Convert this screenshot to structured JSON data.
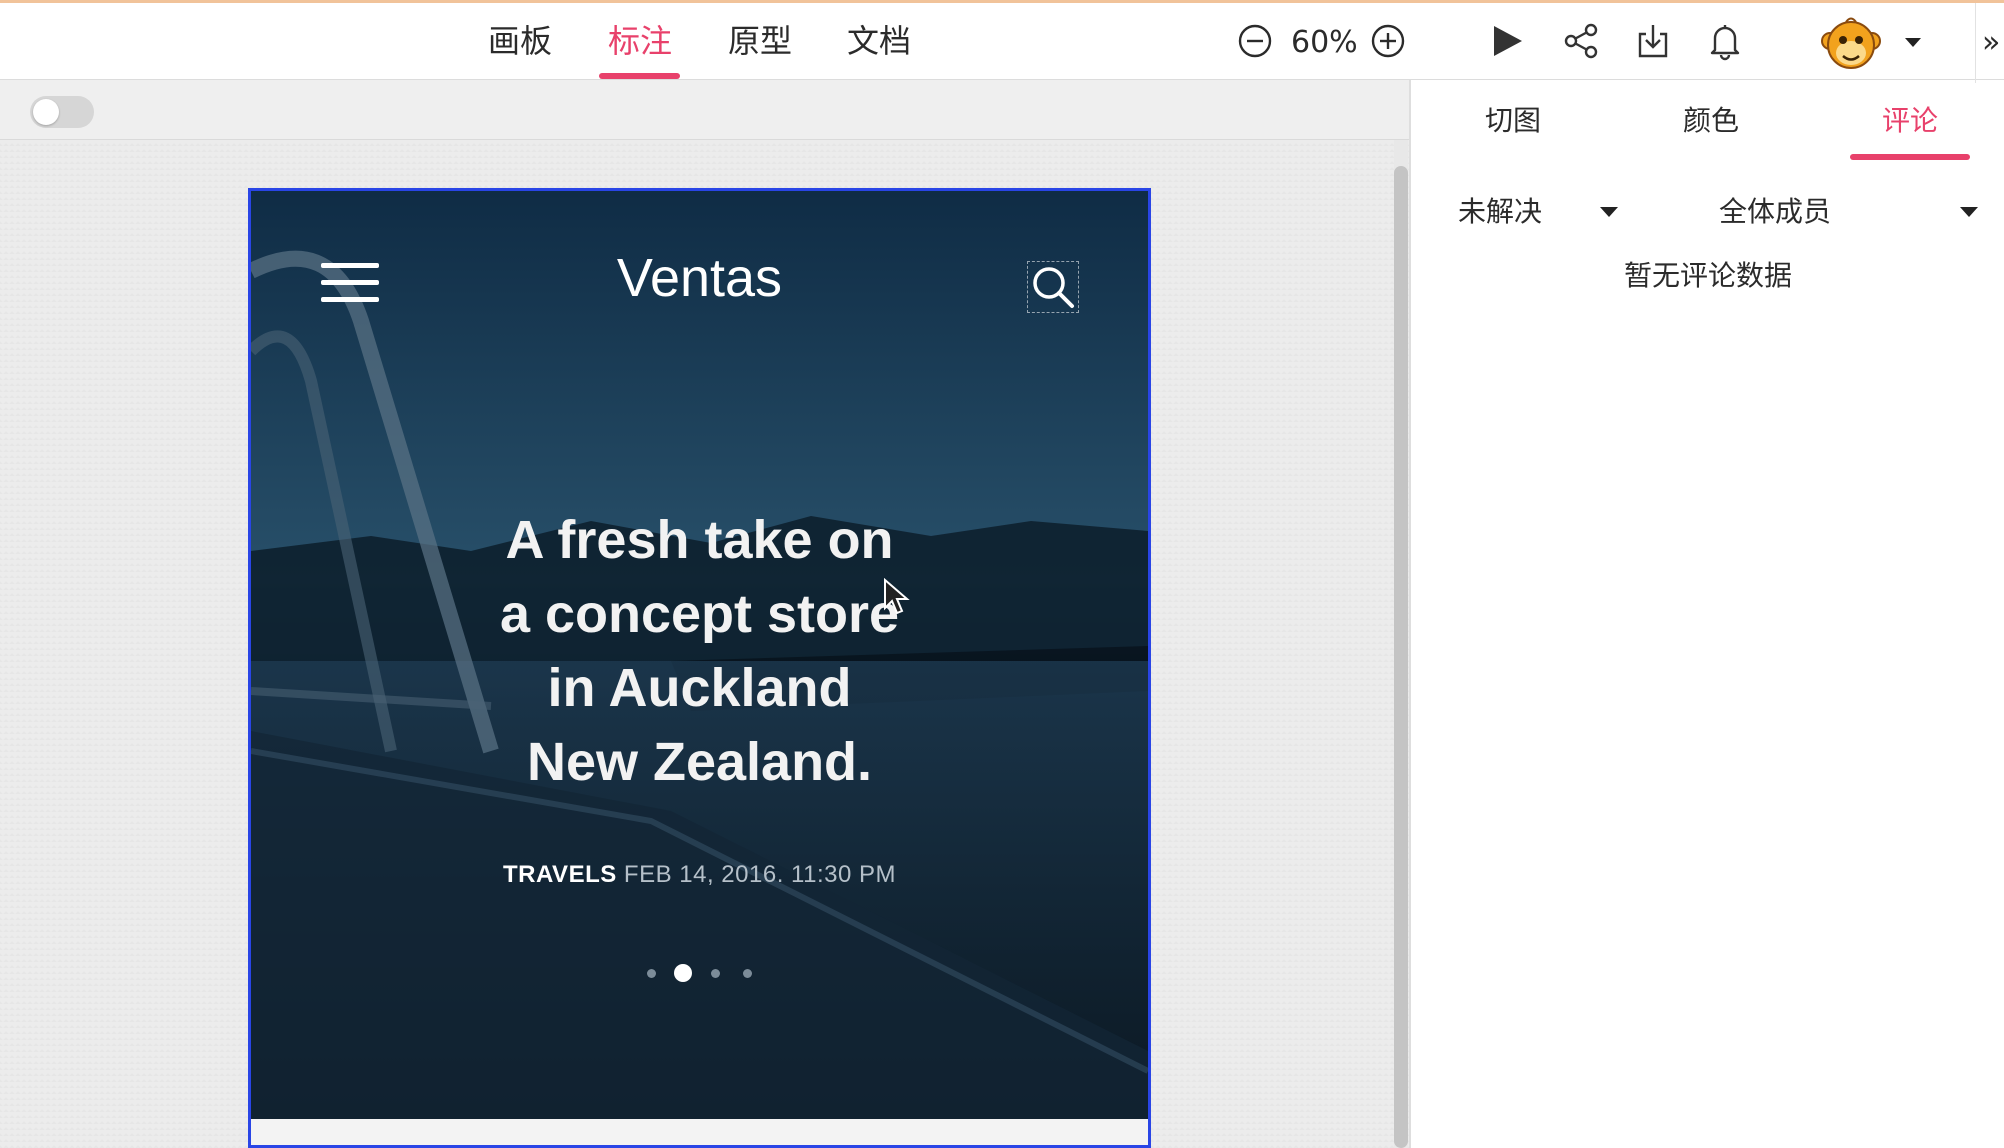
{
  "nav": {
    "tabs": [
      "画板",
      "标注",
      "原型",
      "文档"
    ],
    "active_tab": "标注"
  },
  "zoom": {
    "value": "60%"
  },
  "toolbar_icons": [
    "zoom-out-icon",
    "zoom-in-icon",
    "play-icon",
    "share-icon",
    "download-icon",
    "bell-icon",
    "avatar-monkey",
    "chevron-down-icon",
    "double-chevron-right-icon"
  ],
  "toggle": {
    "on": false
  },
  "artboard": {
    "brand": "Ventas",
    "headline": [
      "A fresh take on",
      "a concept store",
      "in Auckland",
      "New Zealand."
    ],
    "category": "TRAVELS",
    "date": "FEB 14, 2016. 11:30 PM",
    "slides_total": 4,
    "slide_active": 2
  },
  "right_panel": {
    "tabs": [
      "切图",
      "颜色",
      "评论"
    ],
    "active_tab": "评论",
    "filter_status": "未解决",
    "filter_members": "全体成员",
    "empty_message": "暂无评论数据"
  },
  "colors": {
    "accent": "#e8416b",
    "artboard_border": "#2945e6"
  }
}
